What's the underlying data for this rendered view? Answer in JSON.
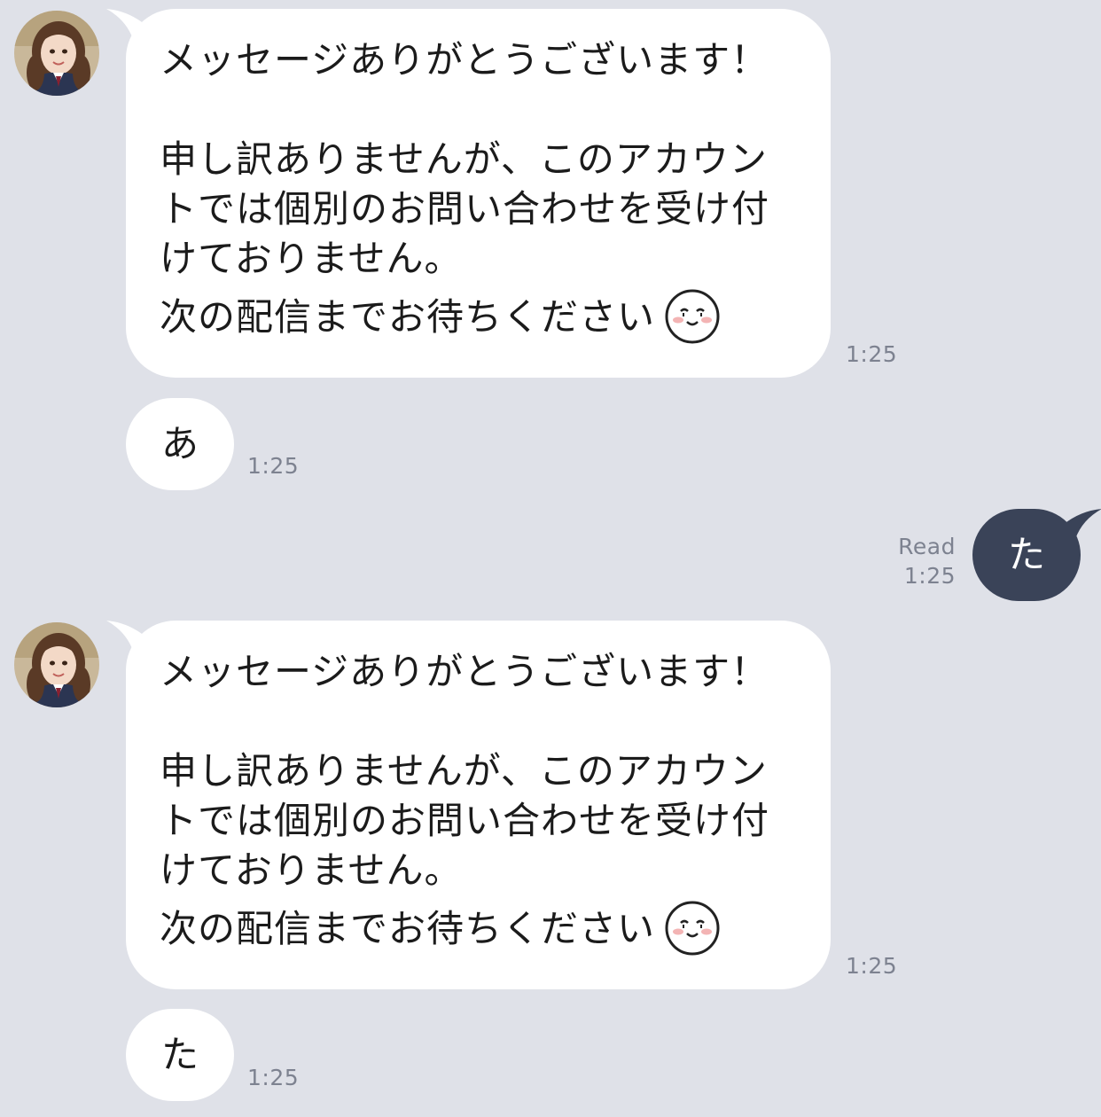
{
  "conversation": {
    "colors": {
      "background": "#dfe1e8",
      "received_bubble": "#ffffff",
      "sent_bubble": "#3a4358",
      "timestamp": "#7d8290"
    },
    "messages": [
      {
        "sender": "account",
        "lines": [
          "メッセージありがとうございます！",
          "申し訳ありませんが、このアカウン",
          "トでは個別のお問い合わせを受け付",
          "けておりません。",
          "次の配信までお待ちください"
        ],
        "emoji": "smiling-face-emoji",
        "time": "1:25"
      },
      {
        "sender": "account",
        "text": "あ",
        "time": "1:25"
      },
      {
        "sender": "me",
        "text": "た",
        "read": "Read",
        "time": "1:25"
      },
      {
        "sender": "account",
        "lines": [
          "メッセージありがとうございます！",
          "申し訳ありませんが、このアカウン",
          "トでは個別のお問い合わせを受け付",
          "けておりません。",
          "次の配信までお待ちください"
        ],
        "emoji": "smiling-face-emoji",
        "time": "1:25"
      },
      {
        "sender": "account",
        "text": "た",
        "time": "1:25"
      }
    ]
  }
}
